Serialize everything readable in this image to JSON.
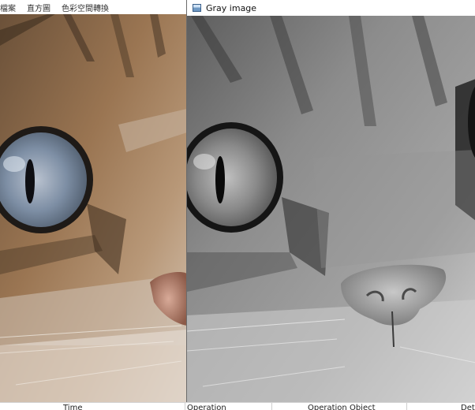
{
  "left_window": {
    "menu": [
      {
        "label": "檔案"
      },
      {
        "label": "直方圖"
      },
      {
        "label": "色彩空間轉換"
      }
    ],
    "image": {
      "subject": "cat face",
      "mode": "color"
    }
  },
  "right_window": {
    "title": "Gray image",
    "image": {
      "subject": "cat face",
      "mode": "grayscale"
    }
  },
  "table": {
    "columns": [
      "Time",
      "Operation",
      "Operation Object",
      "Det"
    ]
  },
  "colors": {
    "fur_color": "#8a6a48",
    "fur_gray": "#8a8a8a",
    "eye_color": "#6e7e90",
    "nose_color": "#c08f80"
  }
}
